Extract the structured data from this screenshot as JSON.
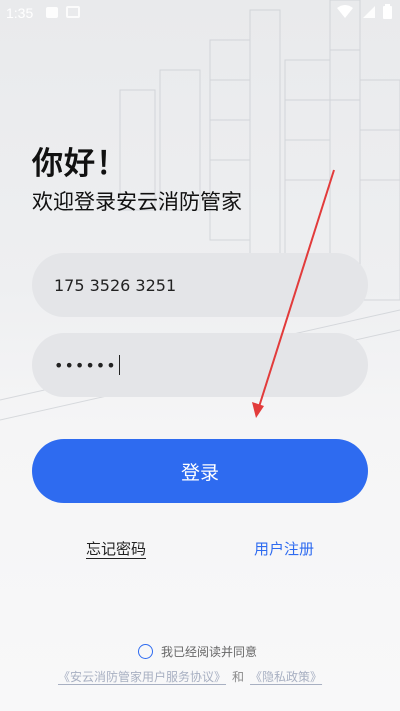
{
  "status_bar": {
    "time": "1:35"
  },
  "header": {
    "greeting": "你好！",
    "welcome": "欢迎登录安云消防管家"
  },
  "form": {
    "phone_value": "175 3526 3251",
    "password_value": "••••••"
  },
  "actions": {
    "login_label": "登录",
    "forgot_label": "忘记密码",
    "register_label": "用户注册"
  },
  "agreement": {
    "agree_text": "我已经阅读并同意",
    "service_link": "《安云消防管家用户服务协议》",
    "and_text": "和",
    "privacy_link": "《隐私政策》"
  },
  "colors": {
    "accent": "#2e6bf0",
    "annotation_arrow": "#e23b3b"
  }
}
